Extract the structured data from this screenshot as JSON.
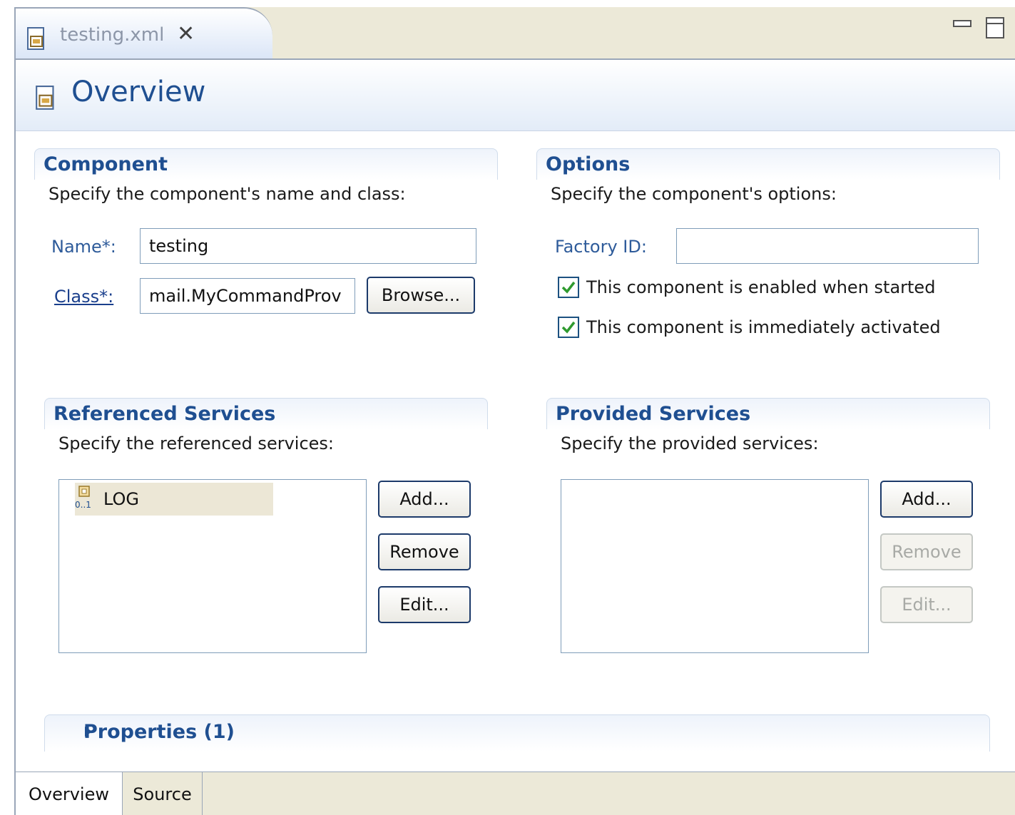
{
  "editor_tab": {
    "label": "testing.xml",
    "close_icon": "close-icon",
    "file_icon": "component-file-icon"
  },
  "header": {
    "title": "Overview",
    "icon": "component-file-icon"
  },
  "component": {
    "title": "Component",
    "description": "Specify the component's name and class:",
    "name_label": "Name*:",
    "name_value": "testing",
    "class_label": "Class*:",
    "class_value": "mail.MyCommandProv",
    "browse_label": "Browse..."
  },
  "options": {
    "title": "Options",
    "description": "Specify the component's options:",
    "factory_label": "Factory ID:",
    "factory_value": "",
    "enabled_label": "This component is enabled when started",
    "enabled_checked": true,
    "activated_label": "This component is immediately activated",
    "activated_checked": true
  },
  "referenced_services": {
    "title": "Referenced Services",
    "description": "Specify the referenced services:",
    "items": [
      {
        "label": "LOG",
        "cardinality": "0..1",
        "icon": "reference-icon"
      }
    ],
    "add_label": "Add...",
    "remove_label": "Remove",
    "edit_label": "Edit..."
  },
  "provided_services": {
    "title": "Provided Services",
    "description": "Specify the provided services:",
    "items": [],
    "add_label": "Add...",
    "remove_label": "Remove",
    "edit_label": "Edit..."
  },
  "properties": {
    "title": "Properties (1)",
    "expanded": false
  },
  "page_tabs": [
    {
      "label": "Overview",
      "selected": true
    },
    {
      "label": "Source",
      "selected": false
    }
  ],
  "colors": {
    "section_title": "#1f4f91",
    "label": "#2e5b9a",
    "check": "#2f9a2f",
    "frame": "#ece9d8"
  }
}
